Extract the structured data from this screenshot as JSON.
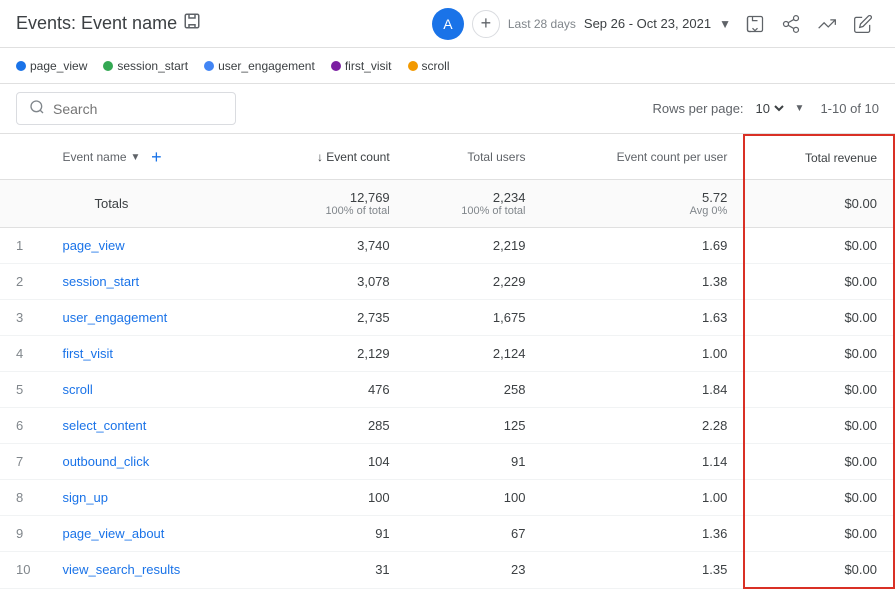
{
  "header": {
    "title": "Events: Event name",
    "save_icon": "💾",
    "avatar_label": "A",
    "add_label": "+",
    "date_label": "Last 28 days",
    "date_range": "Sep 26 - Oct 23, 2021",
    "date_icon": "▼",
    "share_icon": "⬆",
    "explore_icon": "〜",
    "pencil_icon": "✏"
  },
  "legend": {
    "items": [
      {
        "label": "page_view",
        "color": "#1a73e8"
      },
      {
        "label": "session_start",
        "color": "#34a853"
      },
      {
        "label": "user_engagement",
        "color": "#4285f4"
      },
      {
        "label": "first_visit",
        "color": "#7b1fa2"
      },
      {
        "label": "scroll",
        "color": "#f29900"
      }
    ]
  },
  "toolbar": {
    "search_placeholder": "Search",
    "rows_per_page_label": "Rows per page:",
    "rows_per_page_value": "10",
    "pagination": "1-10 of 10"
  },
  "table": {
    "columns": [
      {
        "id": "num",
        "label": ""
      },
      {
        "id": "event_name",
        "label": "Event name",
        "sortable": false
      },
      {
        "id": "event_count",
        "label": "↓ Event count",
        "sortable": true
      },
      {
        "id": "total_users",
        "label": "Total users",
        "sortable": false
      },
      {
        "id": "event_count_per_user",
        "label": "Event count per user",
        "sortable": false
      },
      {
        "id": "total_revenue",
        "label": "Total revenue",
        "highlight": true
      }
    ],
    "totals": {
      "event_name": "Totals",
      "event_count": "12,769",
      "event_count_sub": "100% of total",
      "total_users": "2,234",
      "total_users_sub": "100% of total",
      "event_count_per_user": "5.72",
      "event_count_per_user_sub": "Avg 0%",
      "total_revenue": "$0.00"
    },
    "rows": [
      {
        "num": 1,
        "event_name": "page_view",
        "event_count": "3,740",
        "total_users": "2,219",
        "event_count_per_user": "1.69",
        "total_revenue": "$0.00"
      },
      {
        "num": 2,
        "event_name": "session_start",
        "event_count": "3,078",
        "total_users": "2,229",
        "event_count_per_user": "1.38",
        "total_revenue": "$0.00"
      },
      {
        "num": 3,
        "event_name": "user_engagement",
        "event_count": "2,735",
        "total_users": "1,675",
        "event_count_per_user": "1.63",
        "total_revenue": "$0.00"
      },
      {
        "num": 4,
        "event_name": "first_visit",
        "event_count": "2,129",
        "total_users": "2,124",
        "event_count_per_user": "1.00",
        "total_revenue": "$0.00"
      },
      {
        "num": 5,
        "event_name": "scroll",
        "event_count": "476",
        "total_users": "258",
        "event_count_per_user": "1.84",
        "total_revenue": "$0.00"
      },
      {
        "num": 6,
        "event_name": "select_content",
        "event_count": "285",
        "total_users": "125",
        "event_count_per_user": "2.28",
        "total_revenue": "$0.00"
      },
      {
        "num": 7,
        "event_name": "outbound_click",
        "event_count": "104",
        "total_users": "91",
        "event_count_per_user": "1.14",
        "total_revenue": "$0.00"
      },
      {
        "num": 8,
        "event_name": "sign_up",
        "event_count": "100",
        "total_users": "100",
        "event_count_per_user": "1.00",
        "total_revenue": "$0.00"
      },
      {
        "num": 9,
        "event_name": "page_view_about",
        "event_count": "91",
        "total_users": "67",
        "event_count_per_user": "1.36",
        "total_revenue": "$0.00"
      },
      {
        "num": 10,
        "event_name": "view_search_results",
        "event_count": "31",
        "total_users": "23",
        "event_count_per_user": "1.35",
        "total_revenue": "$0.00"
      }
    ]
  },
  "accent_color": "#d93025",
  "link_color": "#1a73e8"
}
